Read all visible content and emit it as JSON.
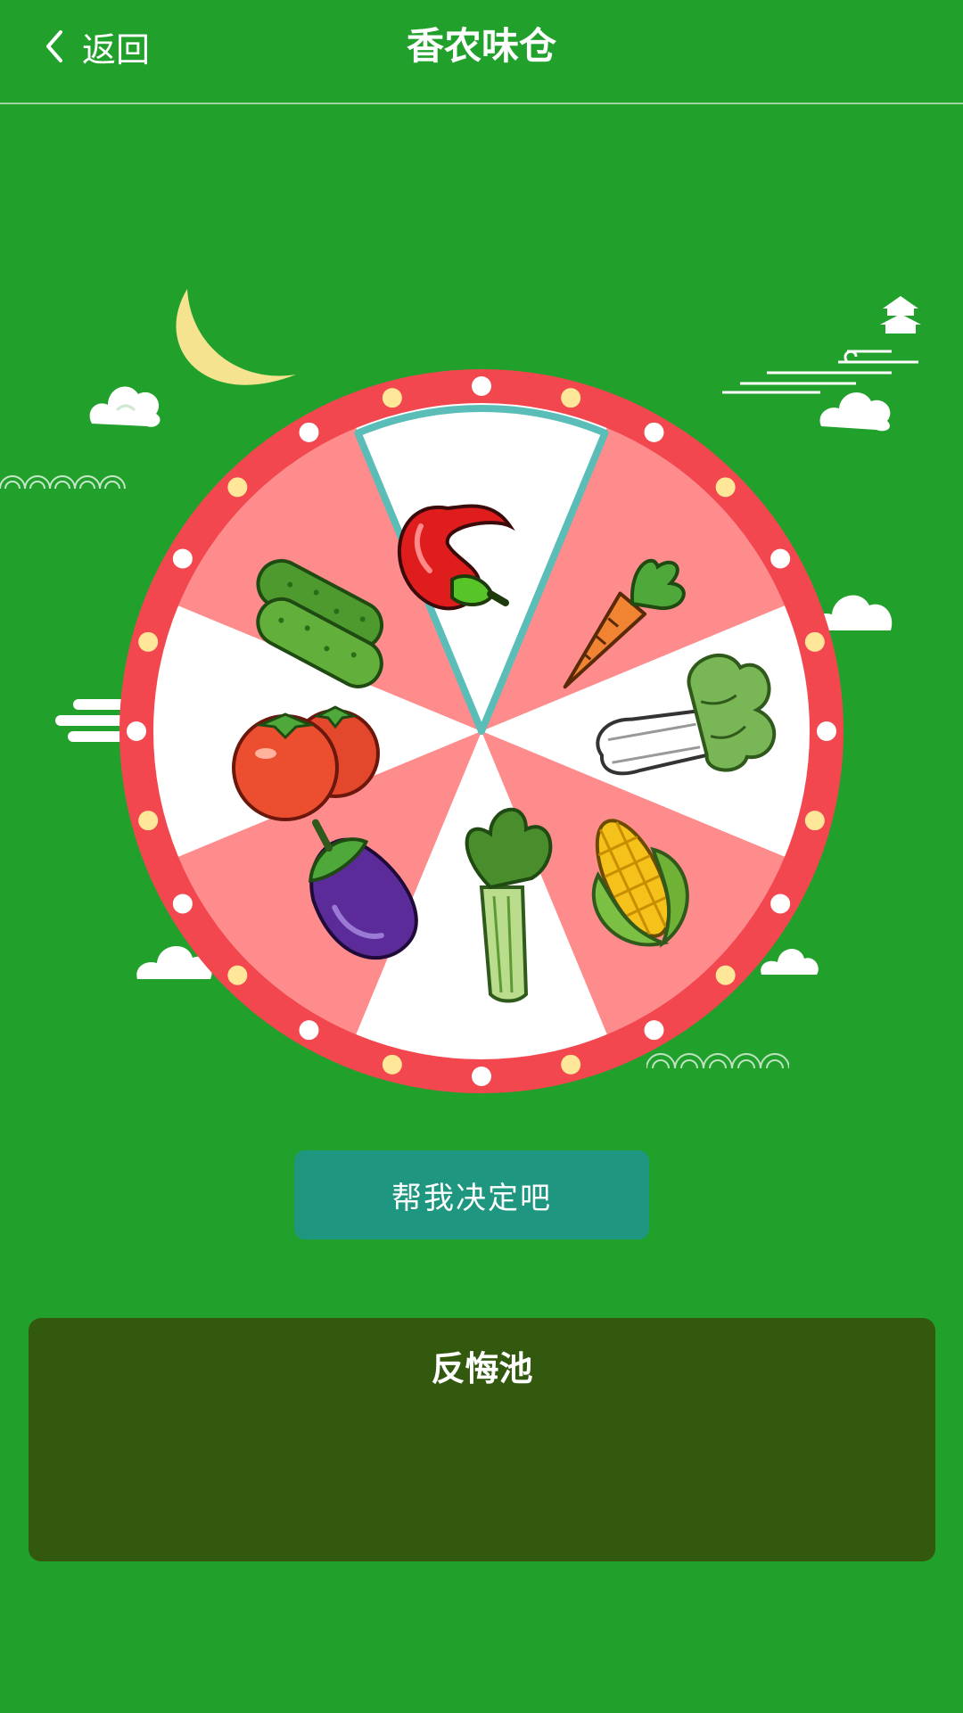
{
  "header": {
    "back_label": "返回",
    "title": "香农味仓"
  },
  "wheel": {
    "segments": [
      {
        "icon": "chili-pepper-icon",
        "highlighted": true
      },
      {
        "icon": "carrot-icon"
      },
      {
        "icon": "bok-choy-icon"
      },
      {
        "icon": "corn-icon"
      },
      {
        "icon": "celery-icon"
      },
      {
        "icon": "eggplant-icon"
      },
      {
        "icon": "tomato-icon"
      },
      {
        "icon": "cucumber-icon"
      }
    ],
    "colors": {
      "rim": "#f2474f",
      "pink_segment": "#ff8c8c",
      "white_segment": "#ffffff",
      "highlight_border": "#5bbdb7",
      "bulb_white": "#ffffff",
      "bulb_yellow": "#ffe79a"
    }
  },
  "actions": {
    "decide_label": "帮我决定吧"
  },
  "regret_pool": {
    "title": "反悔池"
  },
  "colors": {
    "background": "#22a02c",
    "button": "#1e9680",
    "panel": "#33590f"
  }
}
